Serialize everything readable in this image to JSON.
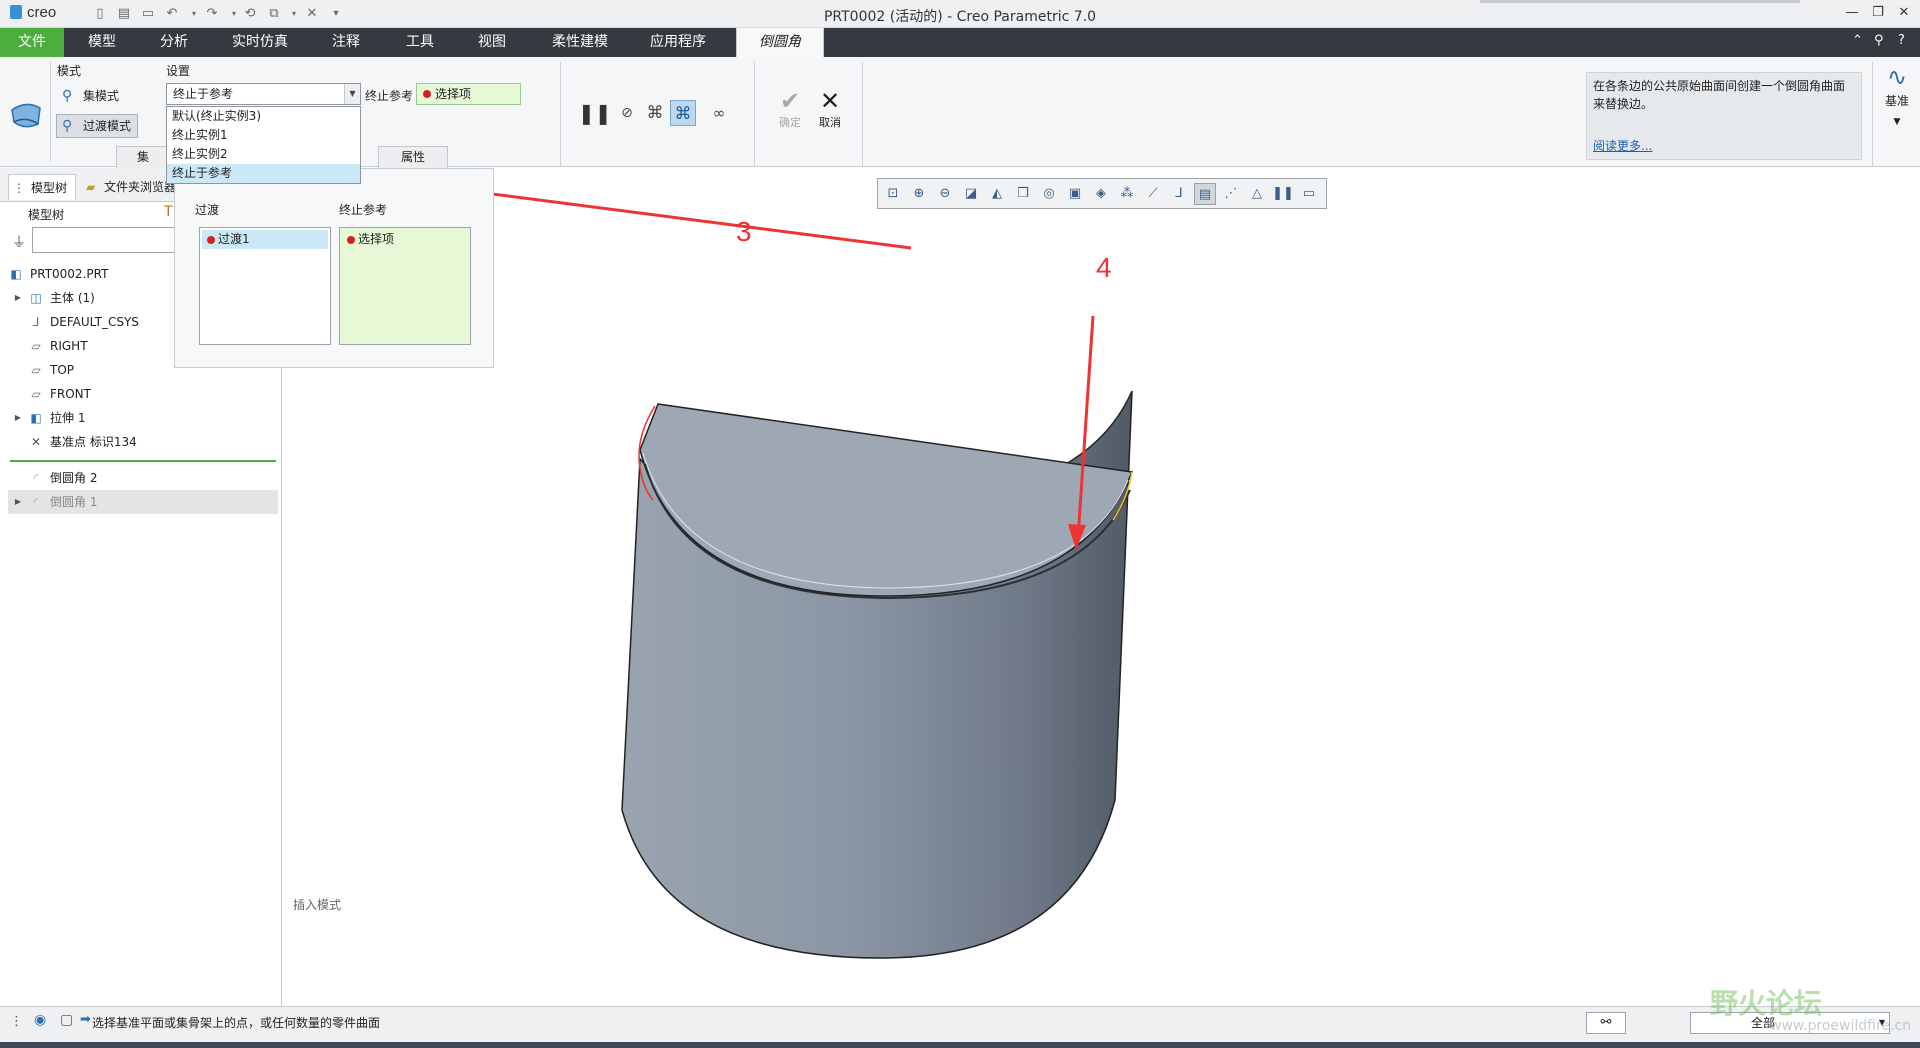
{
  "app": {
    "logo": "creo",
    "window_title": "PRT0002 (活动的) - Creo Parametric 7.0"
  },
  "menubar": {
    "tabs": [
      "文件",
      "模型",
      "分析",
      "实时仿真",
      "注释",
      "工具",
      "视图",
      "柔性建模",
      "应用程序",
      "倒圆角"
    ],
    "active_tab": "倒圆角"
  },
  "ribbon": {
    "mode_label": "模式",
    "set_mode": "集模式",
    "transition_mode": "过渡模式",
    "settings_label": "设置",
    "combo_value": "终止于参考",
    "stop_ref_label": "终止参考",
    "stop_ref_value": "选择项",
    "dropdown_options": [
      "默认(终止实例3)",
      "终止实例1",
      "终止实例2",
      "终止于参考"
    ],
    "dropdown_selected_index": 3,
    "tabs": [
      "集",
      "属性"
    ],
    "ok": "确定",
    "cancel": "取消",
    "help_text": "在各条边的公共原始曲面间创建一个倒圆角曲面来替换边。",
    "help_more": "阅读更多...",
    "datum": "基准"
  },
  "left_panel": {
    "tab_model_tree": "模型树",
    "tab_folder": "文件夹浏览器",
    "tree_title": "模型树",
    "items": [
      {
        "label": "PRT0002.PRT",
        "icon": "part-icon",
        "expandable": false
      },
      {
        "label": "主体 (1)",
        "icon": "body-icon",
        "expandable": true
      },
      {
        "label": "DEFAULT_CSYS",
        "icon": "csys-icon",
        "expandable": false
      },
      {
        "label": "RIGHT",
        "icon": "plane-icon",
        "expandable": false
      },
      {
        "label": "TOP",
        "icon": "plane-icon",
        "expandable": false
      },
      {
        "label": "FRONT",
        "icon": "plane-icon",
        "expandable": false
      },
      {
        "label": "拉伸 1",
        "icon": "extrude-icon",
        "expandable": true
      },
      {
        "label": "基准点 标识134",
        "icon": "datum-point-icon",
        "expandable": false
      }
    ],
    "after_insert": [
      {
        "label": "倒圆角 2",
        "icon": "round-icon",
        "expandable": false
      },
      {
        "label": "倒圆角 1",
        "icon": "round-icon",
        "expandable": true
      }
    ]
  },
  "flyout": {
    "transition_label": "过渡",
    "stop_ref_label": "终止参考",
    "transition_item": "过渡1",
    "stop_ref_item": "选择项"
  },
  "graphics": {
    "insert_mode": "插入模式",
    "annotation_3": "3",
    "annotation_4": "4"
  },
  "statusbar": {
    "message": "选择基准平面或集骨架上的点，或任何数量的零件曲面",
    "filter_value": "全部"
  },
  "watermark": {
    "text": "野火论坛",
    "url": "www.proewildfire.cn"
  },
  "colors": {
    "menubar_bg": "#343a40",
    "file_tab": "#4cae3f",
    "selection": "#cbe8f6",
    "collector_bg": "#e7f8d6",
    "annotation": "#ee3333",
    "model_body": "#8a95a3"
  }
}
